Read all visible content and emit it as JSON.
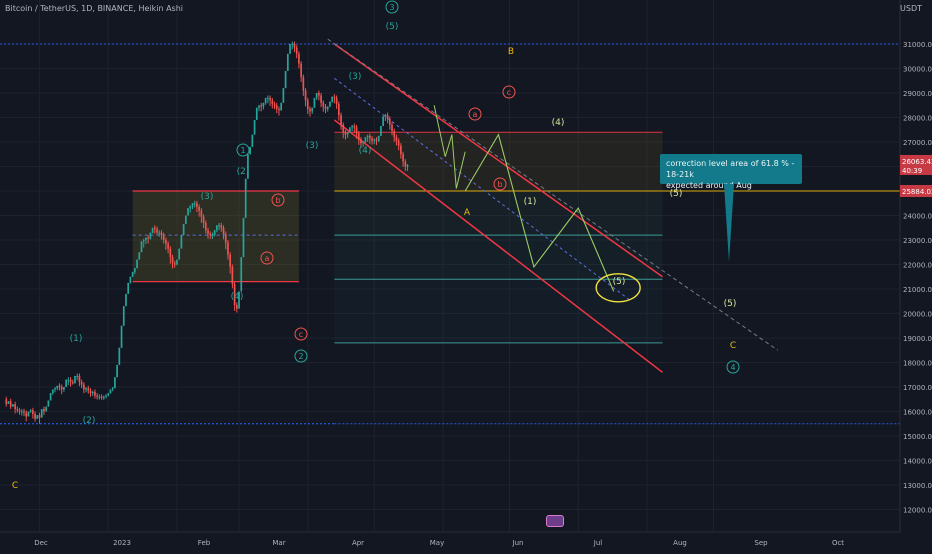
{
  "header": {
    "symbol_line": "Bitcoin / TetherUS, 1D, BINANCE, Heikin Ashi"
  },
  "axis": {
    "currency": "USDT"
  },
  "callout": {
    "line1": "correction level area of 61.8 % - 18-21k",
    "line2": "expected around Aug"
  },
  "colors": {
    "background": "#131722",
    "bull": "#26a69a",
    "bear": "#ef5350",
    "channel": "#f23645",
    "gold": "#f0b90b",
    "cyan": "#4dd0c4",
    "blue_dotted": "#2962ff",
    "projection": "#9ccc65",
    "callout": "#127a8a"
  },
  "chart_data": {
    "type": "candlestick",
    "title": "Bitcoin / TetherUS, 1D, BINANCE, Heikin Ashi",
    "y_axis": {
      "side": "right",
      "unit": "USDT",
      "range": [
        10500,
        32500
      ],
      "ticks": [
        "11000.00",
        "12000.00",
        "13000.00",
        "14000.00",
        "15000.00",
        "16000.00",
        "17000.00",
        "18000.00",
        "19000.00",
        "20000.00",
        "21000.00",
        "22000.00",
        "23000.00",
        "24000.00",
        "25000.00",
        "26000.00",
        "27000.00",
        "28000.00",
        "29000.00",
        "30000.00",
        "31000.00"
      ]
    },
    "x_axis": {
      "ticks": [
        "Dec",
        "2023",
        "Feb",
        "Mar",
        "Apr",
        "May",
        "Jun",
        "Jul",
        "Aug",
        "Sep",
        "Oct"
      ]
    },
    "price_labels": {
      "last": "26063.43",
      "countdown": "40:39",
      "level": "25884.03"
    },
    "horizontal_levels": [
      {
        "price": 31000,
        "style": "blue-dotted"
      },
      {
        "price": 15500,
        "style": "blue-dotted"
      },
      {
        "price": 27400,
        "style": "red"
      },
      {
        "price": 25000,
        "style": "gold"
      },
      {
        "price": 23200,
        "style": "teal"
      },
      {
        "price": 21400,
        "style": "teal"
      },
      {
        "price": 18800,
        "style": "teal"
      }
    ],
    "ranges": [
      {
        "x_from": "2023-01-12",
        "x_to": "2023-03-28",
        "high": 25000,
        "low": 21300
      }
    ],
    "channel": {
      "upper": [
        [
          "2023-04-13",
          31000
        ],
        [
          "2023-09-08",
          21500
        ]
      ],
      "lower": [
        [
          "2023-04-13",
          27900
        ],
        [
          "2023-09-08",
          17600
        ]
      ]
    },
    "projection_path": [
      [
        "2023-06-11",
        25000
      ],
      [
        "2023-06-26",
        27300
      ],
      [
        "2023-07-12",
        21900
      ],
      [
        "2023-08-01",
        24300
      ],
      [
        "2023-08-17",
        20900
      ]
    ],
    "wave_labels": [
      "(1)",
      "(2)",
      "(3)",
      "(4)",
      "(5)",
      "(3)",
      "(4)",
      "(5)",
      "(1)",
      "(2)",
      "(3)",
      "(4)",
      "(5)",
      "(1)",
      "(2)",
      "(3)",
      "(4)",
      "(5)",
      "a",
      "b",
      "c",
      "a",
      "b",
      "c",
      "A",
      "B",
      "C",
      "C",
      "1",
      "2",
      "3",
      "4"
    ],
    "candles": [
      [
        -8.0,
        16500,
        16600,
        16200,
        16310
      ],
      [
        -7.0,
        16310,
        16410,
        16350,
        16420
      ],
      [
        -6.0,
        16420,
        16520,
        16100,
        16200
      ],
      [
        -5.0,
        16200,
        16300,
        16200,
        16300
      ],
      [
        -4.0,
        16300,
        16400,
        15920,
        16100
      ],
      [
        -3.0,
        16100,
        16200,
        15950,
        16050
      ],
      [
        -2.0,
        16050,
        16150,
        15870,
        16000
      ],
      [
        -1.0,
        16000,
        16100,
        15840,
        16010
      ],
      [
        0.0,
        16010,
        16110,
        15810,
        15950
      ],
      [
        1.0,
        15950,
        16050,
        15600,
        15800
      ],
      [
        2.0,
        15800,
        15900,
        15850,
        16000
      ],
      [
        3.0,
        16000,
        16100,
        15940,
        16050
      ],
      [
        4.0,
        16050,
        16150,
        15710,
        15900
      ],
      [
        5.0,
        15900,
        16000,
        15580,
        15700
      ],
      [
        6.0,
        15700,
        15800,
        15700,
        15850
      ],
      [
        7.0,
        15850,
        15950,
        15500,
        15750
      ],
      [
        8.0,
        15750,
        15850,
        15960,
        16100
      ],
      [
        9.0,
        16100,
        16200,
        15860,
        16000
      ],
      [
        10.0,
        16000,
        16100,
        16020,
        16200
      ],
      [
        11.0,
        16200,
        16300,
        16250,
        16450
      ],
      [
        12.0,
        16450,
        16550,
        16540,
        16750
      ],
      [
        13.0,
        16750,
        16850,
        16680,
        16900
      ],
      [
        14.0,
        16900,
        17000,
        16780,
        16950
      ],
      [
        15.0,
        16950,
        17050,
        16870,
        17050
      ],
      [
        16.0,
        17050,
        17150,
        16860,
        17000
      ],
      [
        17.0,
        17000,
        17100,
        16710,
        16900
      ],
      [
        18.0,
        16900,
        17000,
        16800,
        17000
      ],
      [
        19.0,
        17000,
        17100,
        17020,
        17300
      ],
      [
        20.0,
        17300,
        17400,
        17080,
        17300
      ],
      [
        21.0,
        17300,
        17400,
        17020,
        17200
      ],
      [
        22.0,
        17200,
        17300,
        17100,
        17150
      ],
      [
        23.0,
        17150,
        17250,
        17190,
        17450
      ],
      [
        24.0,
        17450,
        17550,
        17280,
        17450
      ],
      [
        25.0,
        17450,
        17550,
        17030,
        17200
      ],
      [
        26.0,
        17200,
        17300,
        16960,
        17100
      ],
      [
        27.0,
        17100,
        17200,
        16750,
        16900
      ],
      [
        28.0,
        16900,
        17000,
        16780,
        16950
      ],
      [
        29.0,
        16950,
        17050,
        16730,
        16850
      ],
      [
        30.0,
        16850,
        16950,
        16600,
        16750
      ],
      [
        31.0,
        16750,
        16850,
        16630,
        16800
      ],
      [
        32.0,
        16800,
        16900,
        16530,
        16650
      ],
      [
        33.0,
        16650,
        16750,
        16490,
        16600
      ],
      [
        34.0,
        16600,
        16700,
        16490,
        16600
      ],
      [
        35.0,
        16600,
        16700,
        16480,
        16550
      ],
      [
        36.0,
        16550,
        16650,
        16470,
        16600
      ],
      [
        37.0,
        16600,
        16700,
        16530,
        16650
      ],
      [
        38.0,
        16650,
        16750,
        16620,
        16750
      ],
      [
        39.0,
        16750,
        16850,
        16730,
        16900
      ],
      [
        40.0,
        16900,
        17000,
        16830,
        16950
      ],
      [
        41.0,
        16950,
        17050,
        17220,
        17400
      ],
      [
        42.0,
        17400,
        17500,
        17680,
        17900
      ],
      [
        43.0,
        17900,
        18000,
        18330,
        18600
      ],
      [
        44.0,
        18600,
        18700,
        19180,
        19500
      ],
      [
        45.0,
        19500,
        19600,
        19960,
        20300
      ],
      [
        46.0,
        20300,
        20400,
        20460,
        20800
      ],
      [
        47.0,
        20800,
        20900,
        20910,
        21250
      ],
      [
        48.0,
        21250,
        21350,
        21220,
        21500
      ],
      [
        49.0,
        21500,
        21600,
        21480,
        21700
      ],
      [
        50.0,
        21700,
        21800,
        21610,
        21850
      ],
      [
        51.0,
        21850,
        21950,
        21920,
        22200
      ],
      [
        52.0,
        22200,
        22300,
        22240,
        22500
      ],
      [
        53.0,
        22500,
        22600,
        22690,
        22950
      ],
      [
        54.0,
        22950,
        23050,
        22690,
        23000
      ],
      [
        55.0,
        23000,
        23100,
        22840,
        23100
      ],
      [
        56.0,
        23100,
        23200,
        22860,
        23050
      ],
      [
        57.0,
        23050,
        23150,
        23020,
        23300
      ],
      [
        58.0,
        23300,
        23400,
        23270,
        23500
      ],
      [
        59.0,
        23500,
        23600,
        23270,
        23450
      ],
      [
        60.0,
        23450,
        23550,
        23200,
        23300
      ],
      [
        61.0,
        23300,
        23400,
        23130,
        23300
      ],
      [
        62.0,
        23300,
        23400,
        23020,
        23200
      ],
      [
        63.0,
        23200,
        23300,
        22860,
        23000
      ],
      [
        64.0,
        23000,
        23100,
        22600,
        22850
      ],
      [
        65.0,
        22850,
        22950,
        22460,
        22650
      ],
      [
        66.0,
        22650,
        22750,
        22030,
        22300
      ],
      [
        67.0,
        22300,
        22400,
        21840,
        22050
      ],
      [
        68.0,
        22050,
        22150,
        21870,
        22000
      ],
      [
        69.0,
        22000,
        22100,
        21970,
        22200
      ],
      [
        70.0,
        22200,
        22300,
        22250,
        22650
      ],
      [
        71.0,
        22650,
        22750,
        22810,
        23200
      ],
      [
        72.0,
        23200,
        23300,
        23340,
        23650
      ],
      [
        73.0,
        23650,
        23750,
        23650,
        24000
      ],
      [
        74.0,
        24000,
        24100,
        24000,
        24300
      ],
      [
        75.0,
        24300,
        24400,
        24120,
        24400
      ],
      [
        76.0,
        24400,
        24500,
        24260,
        24500
      ],
      [
        77.0,
        24500,
        24600,
        24330,
        24500
      ],
      [
        78.0,
        24500,
        24600,
        24140,
        24350
      ],
      [
        79.0,
        24350,
        24450,
        23950,
        24200
      ],
      [
        80.0,
        24200,
        24300,
        23700,
        23950
      ],
      [
        81.0,
        23950,
        24050,
        23490,
        23700
      ],
      [
        82.0,
        23700,
        23800,
        23260,
        23400
      ],
      [
        83.0,
        23400,
        23500,
        23050,
        23250
      ],
      [
        84.0,
        23250,
        23350,
        23040,
        23200
      ],
      [
        85.0,
        23200,
        23300,
        23040,
        23200
      ],
      [
        86.0,
        23200,
        23300,
        23150,
        23400
      ],
      [
        87.0,
        23400,
        23500,
        23320,
        23600
      ],
      [
        88.0,
        23600,
        23700,
        23400,
        23600
      ],
      [
        89.0,
        23600,
        23700,
        23340,
        23500
      ],
      [
        90.0,
        23500,
        23600,
        23030,
        23250
      ],
      [
        91.0,
        23250,
        23350,
        22620,
        22900
      ],
      [
        92.0,
        22900,
        23000,
        22200,
        22400
      ],
      [
        93.0,
        22400,
        22500,
        21630,
        21900
      ],
      [
        94.0,
        21900,
        22000,
        21030,
        21200
      ],
      [
        95.0,
        21200,
        21300,
        20110,
        20350
      ],
      [
        96.0,
        20350,
        20450,
        20040,
        20200
      ],
      [
        97.0,
        20200,
        20300,
        20520,
        20900
      ],
      [
        98.0,
        20900,
        21000,
        21880,
        22300
      ],
      [
        99.0,
        22300,
        22400,
        23410,
        23900
      ],
      [
        100.0,
        23900,
        24000,
        25090,
        25500
      ],
      [
        101.0,
        25500,
        25600,
        26120,
        26500
      ],
      [
        102.0,
        26500,
        26600,
        26540,
        26800
      ],
      [
        103.0,
        26800,
        26900,
        26990,
        27300
      ],
      [
        104.0,
        27300,
        27400,
        27520,
        27900
      ],
      [
        105.0,
        27900,
        28000,
        28060,
        28400
      ],
      [
        106.0,
        28400,
        28500,
        28260,
        28500
      ],
      [
        107.0,
        28500,
        28600,
        28250,
        28450
      ],
      [
        108.0,
        28450,
        28550,
        28330,
        28600
      ],
      [
        109.0,
        28600,
        28700,
        28520,
        28800
      ],
      [
        110.0,
        28800,
        28900,
        28580,
        28800
      ],
      [
        111.0,
        28800,
        28900,
        28470,
        28700
      ],
      [
        112.0,
        28700,
        28800,
        28370,
        28550
      ],
      [
        113.0,
        28550,
        28650,
        28340,
        28500
      ],
      [
        114.0,
        28500,
        28600,
        28180,
        28350
      ],
      [
        115.0,
        28350,
        28450,
        28080,
        28300
      ],
      [
        116.0,
        28300,
        28400,
        28270,
        28600
      ],
      [
        117.0,
        28600,
        28700,
        28770,
        29200
      ],
      [
        118.0,
        29200,
        29300,
        29520,
        29900
      ],
      [
        119.0,
        29900,
        30000,
        30310,
        30600
      ],
      [
        120.0,
        30600,
        30700,
        30770,
        31000
      ],
      [
        121.0,
        31000,
        31100,
        30780,
        31000
      ],
      [
        122.0,
        31000,
        31100,
        30670,
        30850
      ],
      [
        123.0,
        30850,
        30950,
        30420,
        30600
      ],
      [
        124.0,
        30600,
        30700,
        30010,
        30200
      ],
      [
        125.0,
        30200,
        30300,
        29450,
        29650
      ],
      [
        126.0,
        29650,
        29750,
        28880,
        29100
      ],
      [
        127.0,
        29100,
        29200,
        28460,
        28700
      ],
      [
        128.0,
        28700,
        28800,
        28140,
        28350
      ],
      [
        129.0,
        28350,
        28450,
        28040,
        28250
      ],
      [
        130.0,
        28250,
        28350,
        28150,
        28400
      ],
      [
        131.0,
        28400,
        28500,
        28520,
        28800
      ],
      [
        132.0,
        28800,
        28900,
        28720,
        29000
      ],
      [
        133.0,
        29000,
        29100,
        28700,
        28900
      ],
      [
        134.0,
        28900,
        29000,
        28420,
        28600
      ],
      [
        135.0,
        28600,
        28700,
        28240,
        28450
      ],
      [
        136.0,
        28450,
        28550,
        28180,
        28350
      ],
      [
        137.0,
        28350,
        28450,
        28240,
        28450
      ],
      [
        138.0,
        28450,
        28550,
        28420,
        28650
      ],
      [
        139.0,
        28650,
        28750,
        28600,
        28850
      ],
      [
        140.0,
        28850,
        28950,
        28580,
        28800
      ],
      [
        141.0,
        28800,
        28900,
        28350,
        28550
      ],
      [
        142.0,
        28550,
        28650,
        27870,
        28100
      ],
      [
        143.0,
        28100,
        28200,
        27500,
        27700
      ],
      [
        144.0,
        27700,
        27800,
        27150,
        27400
      ],
      [
        145.0,
        27400,
        27500,
        27100,
        27300
      ],
      [
        146.0,
        27300,
        27400,
        27170,
        27400
      ],
      [
        147.0,
        27400,
        27500,
        27370,
        27600
      ],
      [
        148.0,
        27600,
        27700,
        27440,
        27650
      ],
      [
        149.0,
        27650,
        27750,
        27370,
        27600
      ],
      [
        150.0,
        27600,
        27700,
        27140,
        27350
      ],
      [
        151.0,
        27350,
        27450,
        26880,
        27100
      ],
      [
        152.0,
        27100,
        27200,
        26760,
        26950
      ],
      [
        153.0,
        26950,
        27050,
        26800,
        27000
      ],
      [
        154.0,
        27000,
        27100,
        26960,
        27200
      ],
      [
        155.0,
        27200,
        27300,
        27010,
        27250
      ],
      [
        156.0,
        27250,
        27350,
        26930,
        27150
      ],
      [
        157.0,
        27150,
        27250,
        26890,
        27050
      ],
      [
        158.0,
        27050,
        27150,
        26910,
        27100
      ],
      [
        159.0,
        27100,
        27200,
        26880,
        27050
      ],
      [
        160.0,
        27050,
        27150,
        26990,
        27250
      ],
      [
        161.0,
        27250,
        27350,
        27260,
        27650
      ],
      [
        162.0,
        27650,
        27750,
        27690,
        28050
      ],
      [
        163.0,
        28050,
        28150,
        27860,
        28100
      ],
      [
        164.0,
        28100,
        28200,
        27770,
        27950
      ],
      [
        165.0,
        27950,
        28050,
        27500,
        27700
      ],
      [
        166.0,
        27700,
        27800,
        27280,
        27450
      ],
      [
        167.0,
        27450,
        27550,
        27010,
        27200
      ],
      [
        168.0,
        27200,
        27300,
        26860,
        27050
      ],
      [
        169.0,
        27050,
        27150,
        26660,
        26850
      ],
      [
        170.0,
        26850,
        26950,
        26320,
        26500
      ],
      [
        171.0,
        26500,
        26600,
        25990,
        26200
      ],
      [
        172.0,
        26200,
        26300,
        25820,
        26000
      ],
      [
        173.0,
        26000,
        26100,
        25820,
        26063
      ]
    ]
  }
}
